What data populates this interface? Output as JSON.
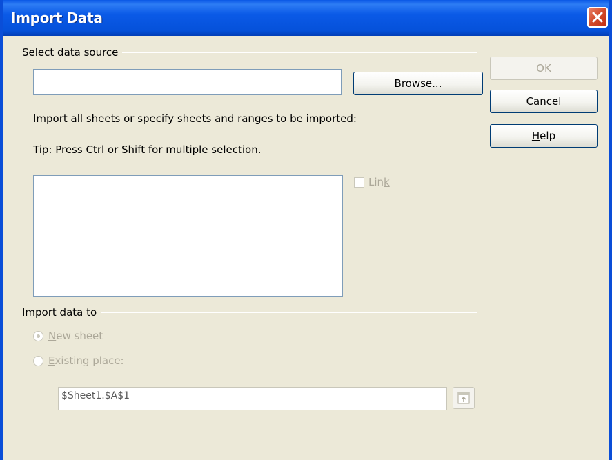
{
  "window": {
    "title": "Import Data",
    "close_icon": "close-icon"
  },
  "source": {
    "section_label": "Select data source",
    "path_value": "",
    "browse_button": {
      "prefix": "",
      "accel": "B",
      "rest": "rowse..."
    },
    "instruction": "Import all sheets or specify sheets and ranges to be imported:",
    "tip": {
      "accel": "T",
      "rest": "ip: Press Ctrl or Shift for multiple selection."
    },
    "link_checkbox": {
      "label_prefix": "Lin",
      "accel": "k",
      "checked": false,
      "enabled": false
    }
  },
  "dest": {
    "section_label": "Import data to",
    "new_sheet": {
      "accel": "N",
      "rest": "ew sheet",
      "selected": true,
      "enabled": false
    },
    "existing_place": {
      "accel": "E",
      "rest": "xisting place:",
      "selected": false,
      "enabled": false
    },
    "reference_value": "$Sheet1.$A$1",
    "shrink_icon": "shrink-icon"
  },
  "buttons": {
    "ok": {
      "label": "OK",
      "enabled": false
    },
    "cancel": {
      "label": "Cancel"
    },
    "help": {
      "accel": "H",
      "rest": "elp"
    }
  },
  "colors": {
    "title_bar": "#0a58e6",
    "dialog_bg": "#ece9d8",
    "close_button": "#d24a2a",
    "disabled_text": "#aca899"
  }
}
